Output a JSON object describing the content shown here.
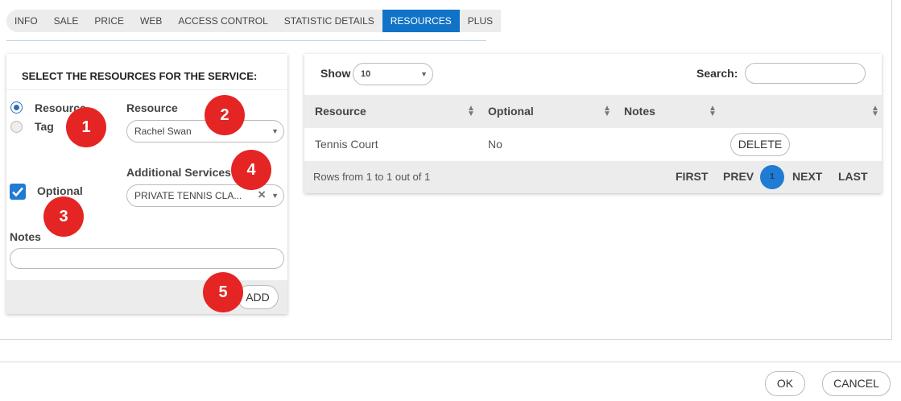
{
  "tabs": [
    {
      "label": "INFO",
      "active": false
    },
    {
      "label": "SALE",
      "active": false
    },
    {
      "label": "PRICE",
      "active": false
    },
    {
      "label": "WEB",
      "active": false
    },
    {
      "label": "ACCESS CONTROL",
      "active": false
    },
    {
      "label": "STATISTIC DETAILS",
      "active": false
    },
    {
      "label": "RESOURCES",
      "active": true
    },
    {
      "label": "PLUS",
      "active": false
    }
  ],
  "form": {
    "title": "SELECT THE RESOURCES FOR THE SERVICE:",
    "type_options": [
      {
        "label": "Resource",
        "checked": true
      },
      {
        "label": "Tag",
        "checked": false
      }
    ],
    "resource_label": "Resource",
    "resource_value": "Rachel Swan",
    "additional_services_label": "Additional Services",
    "additional_services_value": "PRIVATE TENNIS CLA...",
    "optional_label": "Optional",
    "optional_checked": true,
    "notes_label": "Notes",
    "notes_value": "",
    "add_button": "ADD"
  },
  "callouts": [
    "1",
    "2",
    "3",
    "4",
    "5"
  ],
  "table": {
    "show_label": "Show",
    "page_size": "10",
    "search_label": "Search:",
    "search_value": "",
    "columns": [
      "Resource",
      "Optional",
      "Notes",
      ""
    ],
    "rows": [
      {
        "resource": "Tennis Court",
        "optional": "No",
        "notes": "",
        "action": "DELETE"
      }
    ],
    "rows_info": "Rows from 1 to 1 out of 1",
    "pager": {
      "first": "FIRST",
      "prev": "PREV",
      "current": "1",
      "next": "NEXT",
      "last": "LAST"
    }
  },
  "dialog": {
    "ok": "OK",
    "cancel": "CANCEL"
  },
  "colors": {
    "accent": "#1f7bd3",
    "tab_active": "#1173c7",
    "callout": "#e52424"
  }
}
